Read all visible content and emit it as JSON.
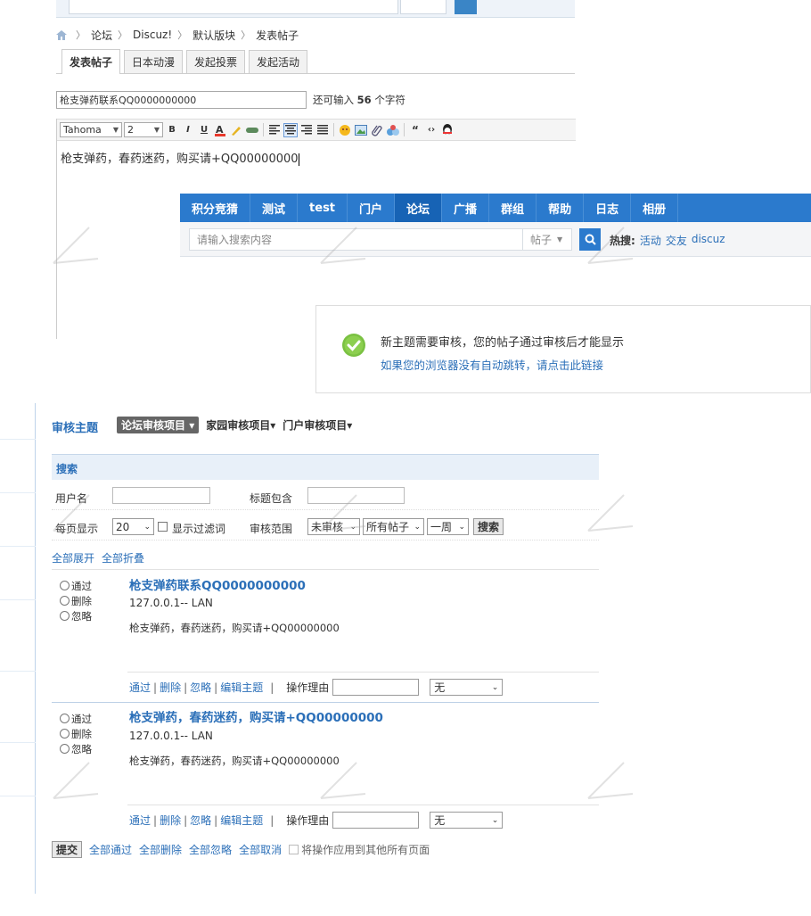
{
  "breadcrumb": {
    "items": [
      "论坛",
      "Discuz!",
      "默认版块",
      "发表帖子"
    ]
  },
  "post_tabs": [
    "发表帖子",
    "日本动漫",
    "发起投票",
    "发起活动"
  ],
  "title_input": {
    "value": "枪支弹药联系QQ0000000000"
  },
  "title_hint": {
    "before": "还可输入",
    "count": "56",
    "after": "个字符"
  },
  "editor": {
    "font": "Tahoma",
    "size": "2",
    "content": "枪支弹药，春药迷药，购买请+QQ00000000"
  },
  "nav": {
    "items": [
      "积分竞猜",
      "测试",
      "test",
      "门户",
      "论坛",
      "广播",
      "群组",
      "帮助",
      "日志",
      "相册"
    ],
    "active_index": 4,
    "search_placeholder": "请输入搜索内容",
    "search_type": "帖子",
    "hot_label": "热搜:",
    "hot_words": [
      "活动",
      "交友",
      "discuz"
    ]
  },
  "notice": {
    "message": "新主题需要审核，您的帖子通过审核后才能显示",
    "link": "如果您的浏览器没有自动跳转，请点击此链接"
  },
  "moderation": {
    "title": "审核主题",
    "tabs": [
      "论坛审核项目",
      "家园审核项目",
      "门户审核项目"
    ],
    "search_label": "搜索",
    "username_label": "用户名",
    "title_contains_label": "标题包含",
    "per_page_label": "每页显示",
    "per_page_value": "20",
    "show_filtered_label": "显示过滤词",
    "scope_label": "审核范围",
    "scope_status": "未审核",
    "scope_posts": "所有帖子",
    "scope_time": "一周",
    "search_button": "搜索",
    "expand_all": "全部展开",
    "collapse_all": "全部折叠",
    "radio_options": [
      "通过",
      "删除",
      "忽略"
    ],
    "posts": [
      {
        "title": "枪支弹药联系QQ0000000000",
        "ip": "127.0.0.1-- LAN",
        "body": "枪支弹药，春药迷药，购买请+QQ00000000"
      },
      {
        "title": "枪支弹药，春药迷药，购买请+QQ00000000",
        "ip": "127.0.0.1-- LAN",
        "body": "枪支弹药，春药迷药，购买请+QQ00000000"
      }
    ],
    "actions": [
      "通过",
      "删除",
      "忽略",
      "编辑主题"
    ],
    "reason_label": "操作理由",
    "reason_select": "无",
    "submit_button": "提交",
    "bulk_actions": [
      "全部通过",
      "全部删除",
      "全部忽略",
      "全部取消"
    ],
    "apply_all_pages": "将操作应用到其他所有页面"
  },
  "colors": {
    "link": "#2b6fb8",
    "nav": "#2b7acd",
    "nav_active": "#1763b5",
    "ok": "#7ac142"
  }
}
